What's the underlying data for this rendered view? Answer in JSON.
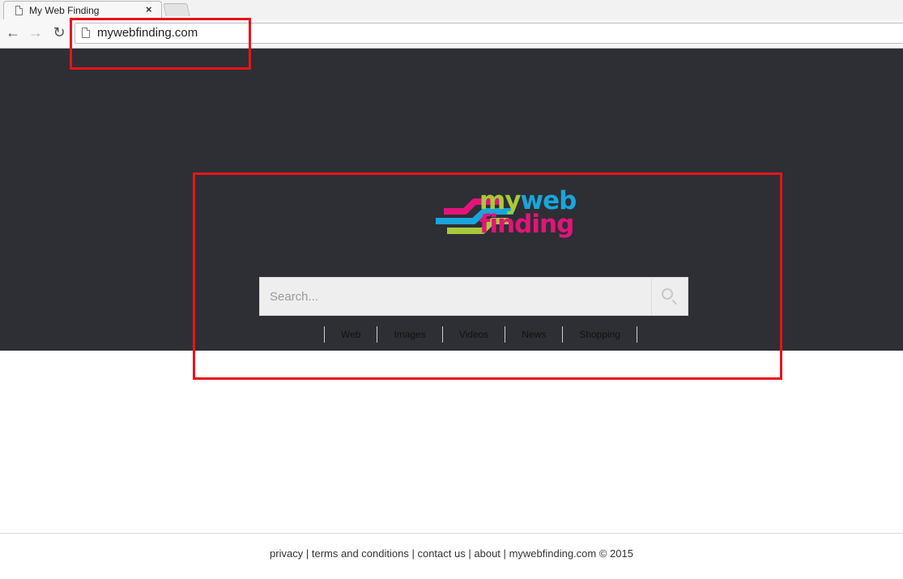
{
  "browser": {
    "tab_title": "My Web Finding",
    "tab_close": "×",
    "url": "mywebfinding.com",
    "icons": {
      "back": "back-arrow-icon",
      "forward": "forward-arrow-icon",
      "reload": "reload-icon",
      "page": "document-icon"
    }
  },
  "logo": {
    "text_my": "my",
    "text_web": "web",
    "text_finding": "finding",
    "colors": {
      "green": "#a8c93a",
      "blue": "#1aa5dc",
      "pink": "#e3147a"
    }
  },
  "search": {
    "placeholder": "Search...",
    "tabs": [
      {
        "label": "Web"
      },
      {
        "label": "Images"
      },
      {
        "label": "Videos"
      },
      {
        "label": "News"
      },
      {
        "label": "Shopping"
      }
    ]
  },
  "footer": {
    "privacy": "privacy",
    "terms": "terms and conditions",
    "contact": "contact us",
    "about": "about",
    "copyright": "mywebfinding.com © 2015",
    "separator": "|"
  },
  "colors": {
    "hero_bg": "#2d2f34",
    "annotation": "#e8141b"
  }
}
